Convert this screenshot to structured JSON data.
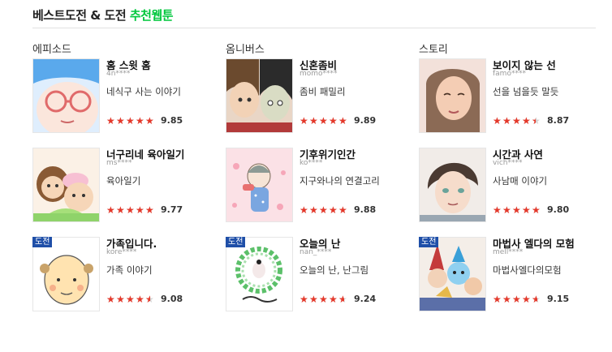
{
  "header": {
    "title_main": "베스트도전 & 도전 ",
    "title_accent": "추천웹툰"
  },
  "colors": {
    "accent": "#00c73c",
    "star": "#e5382a",
    "badge": "#1f4fa8"
  },
  "columns": [
    {
      "title": "에피소드",
      "items": [
        {
          "title": "홈 스윗 홈",
          "author": "4n****",
          "desc": "네식구 사는 이야기",
          "rating": 9.85,
          "badge": ""
        },
        {
          "title": "너구리네 육아일기",
          "author": "ms****",
          "desc": "육아일기",
          "rating": 9.77,
          "badge": ""
        },
        {
          "title": "가족입니다.",
          "author": "kore****",
          "desc": "가족 이야기",
          "rating": 9.08,
          "badge": "도전"
        }
      ]
    },
    {
      "title": "옴니버스",
      "items": [
        {
          "title": "신혼좀비",
          "author": "momo****",
          "desc": "좀비 패밀리",
          "rating": 9.89,
          "badge": ""
        },
        {
          "title": "기후위기인간",
          "author": "ko****",
          "desc": "지구와나의 연결고리",
          "rating": 9.88,
          "badge": ""
        },
        {
          "title": "오늘의 난",
          "author": "nan_****",
          "desc": "오늘의 난, 난그림",
          "rating": 9.24,
          "badge": "도전"
        }
      ]
    },
    {
      "title": "스토리",
      "items": [
        {
          "title": "보이지 않는 선",
          "author": "famo****",
          "desc": "선을 넘을듯 말듯",
          "rating": 8.87,
          "badge": ""
        },
        {
          "title": "시간과 사연",
          "author": "vich****",
          "desc": "사남매 이야기",
          "rating": 9.8,
          "badge": ""
        },
        {
          "title": "마법사 엘다의 모험",
          "author": "mell****",
          "desc": "마법사엘다의모험",
          "rating": 9.15,
          "badge": "도전"
        }
      ]
    }
  ]
}
